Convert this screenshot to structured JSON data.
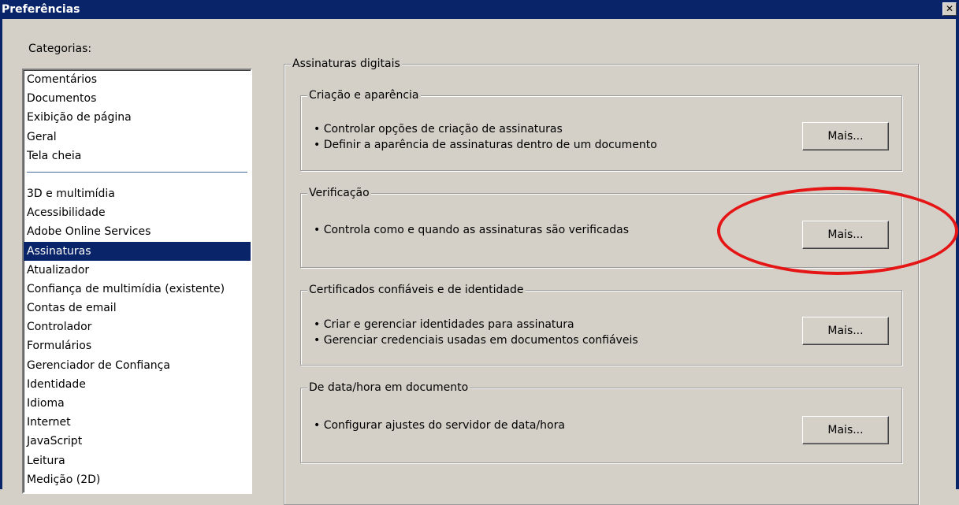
{
  "window": {
    "title": "Preferências",
    "close_symbol": "✕"
  },
  "categories": {
    "label": "Categorias:",
    "group1": [
      "Comentários",
      "Documentos",
      "Exibição de página",
      "Geral",
      "Tela cheia"
    ],
    "group2": [
      "3D e multimídia",
      "Acessibilidade",
      "Adobe Online Services",
      "Assinaturas",
      "Atualizador",
      "Confiança de multimídia (existente)",
      "Contas de email",
      "Controlador",
      "Formulários",
      "Gerenciador de Confiança",
      "Identidade",
      "Idioma",
      "Internet",
      "JavaScript",
      "Leitura",
      "Medição (2D)"
    ],
    "selected": "Assinaturas"
  },
  "panel": {
    "title": "Assinaturas digitais",
    "sections": [
      {
        "title": "Criação e aparência",
        "bullets": [
          "Controlar opções de criação de assinaturas",
          "Definir a aparência de assinaturas dentro de um documento"
        ],
        "button": "Mais..."
      },
      {
        "title": "Verificação",
        "bullets": [
          "Controla como e quando as assinaturas são verificadas"
        ],
        "button": "Mais..."
      },
      {
        "title": "Certificados confiáveis e de identidade",
        "bullets": [
          "Criar e gerenciar identidades para assinatura",
          "Gerenciar credenciais usadas em documentos confiáveis"
        ],
        "button": "Mais..."
      },
      {
        "title": "De data/hora em documento",
        "bullets": [
          "Configurar ajustes do servidor de data/hora"
        ],
        "button": "Mais..."
      }
    ]
  },
  "colors": {
    "titlebar": "#0a246a",
    "dialog_bg": "#d4d0c8",
    "selection": "#0a246a",
    "annotation": "#e51515"
  }
}
